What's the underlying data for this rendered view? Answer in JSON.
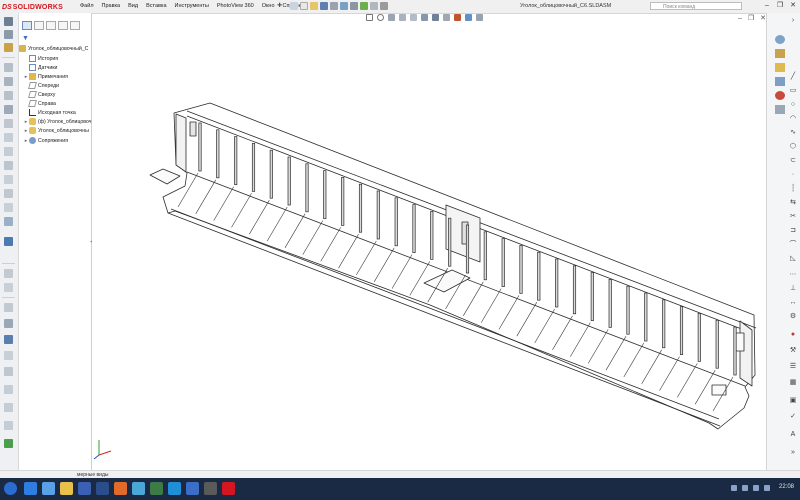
{
  "app": {
    "logo_text": "SOLIDWORKS",
    "logo_mark": "DS"
  },
  "menu": [
    "Файл",
    "Правка",
    "Вид",
    "Вставка",
    "Инструменты",
    "PhotoView 360",
    "Окно",
    "Справка"
  ],
  "document_title": "Уголок_облицовочный_C6.SLDASM",
  "command_search": {
    "placeholder": "Поиск команд"
  },
  "feature_tree": {
    "root": "Уголок_облицовочный_C",
    "items": [
      {
        "label": "История",
        "icon": "history-icon",
        "expandable": false
      },
      {
        "label": "Датчики",
        "icon": "sensors-icon",
        "expandable": false
      },
      {
        "label": "Примечания",
        "icon": "annotations-icon",
        "expandable": true
      },
      {
        "label": "Спереди",
        "icon": "plane-icon",
        "expandable": false
      },
      {
        "label": "Сверху",
        "icon": "plane-icon",
        "expandable": false
      },
      {
        "label": "Справа",
        "icon": "plane-icon",
        "expandable": false
      },
      {
        "label": "Исходная точка",
        "icon": "origin-icon",
        "expandable": false
      },
      {
        "label": "(ф) Уголок_облицовоч",
        "icon": "part-icon",
        "expandable": true
      },
      {
        "label": "Уголок_облицовочны",
        "icon": "part-icon",
        "expandable": true
      },
      {
        "label": "Сопряжения",
        "icon": "mates-icon",
        "expandable": true
      }
    ]
  },
  "view_tabs": {
    "label": "мерные виды"
  },
  "taskbar": {
    "clock": "22:08"
  },
  "colors": {
    "accent": "#d3161f",
    "taskbar": "#1b2a44",
    "panel": "#eef0f3"
  }
}
